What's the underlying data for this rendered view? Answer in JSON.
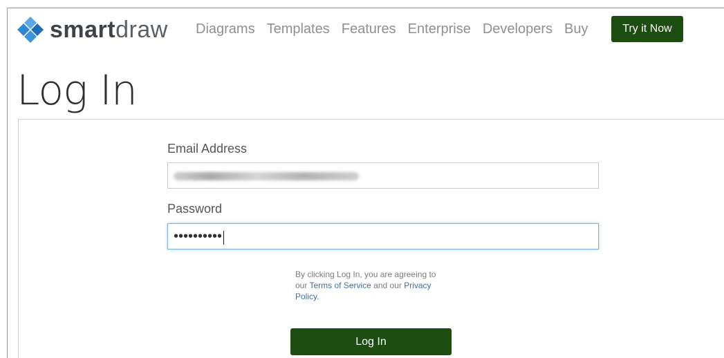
{
  "header": {
    "logo": {
      "brand_bold": "smart",
      "brand_light": "draw"
    },
    "nav": [
      "Diagrams",
      "Templates",
      "Features",
      "Enterprise",
      "Developers",
      "Buy"
    ],
    "cta_label": "Try it Now"
  },
  "page": {
    "title": "Log In"
  },
  "form": {
    "email_label": "Email Address",
    "password_label": "Password",
    "password_value": "••••••••••",
    "legal": {
      "prefix": "By clicking Log In, you are agreeing to our ",
      "terms_link": "Terms of Service",
      "middle": " and our ",
      "privacy_link": "Privacy Policy",
      "suffix": "."
    },
    "submit_label": "Log In"
  },
  "colors": {
    "brand_green": "#1e4d12",
    "link_blue": "#3c6fa6",
    "logo_blue": "#2f86d2"
  }
}
